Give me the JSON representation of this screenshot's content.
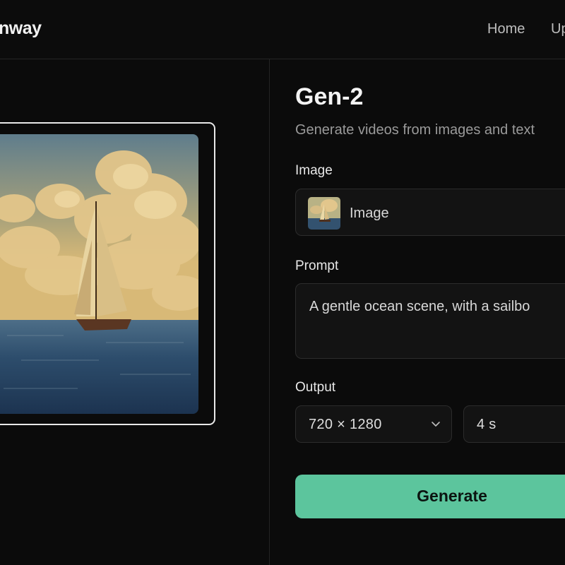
{
  "header": {
    "logo_text": "nway",
    "nav": [
      {
        "label": "Home"
      },
      {
        "label": "Up"
      }
    ]
  },
  "preview": {
    "image_icon": "sailboat-image"
  },
  "form": {
    "title": "Gen-2",
    "subtitle": "Generate videos from images and text",
    "image": {
      "label": "Image",
      "value": "Image",
      "thumbnail_icon": "sailboat-thumbnail"
    },
    "prompt": {
      "label": "Prompt",
      "value": "A gentle ocean scene, with a sailbo"
    },
    "output": {
      "label": "Output",
      "resolution": "720 × 1280",
      "duration": "4 s"
    },
    "generate_label": "Generate"
  },
  "colors": {
    "background": "#0b0b0b",
    "accent": "#5cc59d",
    "field_border": "#2c2c2c"
  }
}
